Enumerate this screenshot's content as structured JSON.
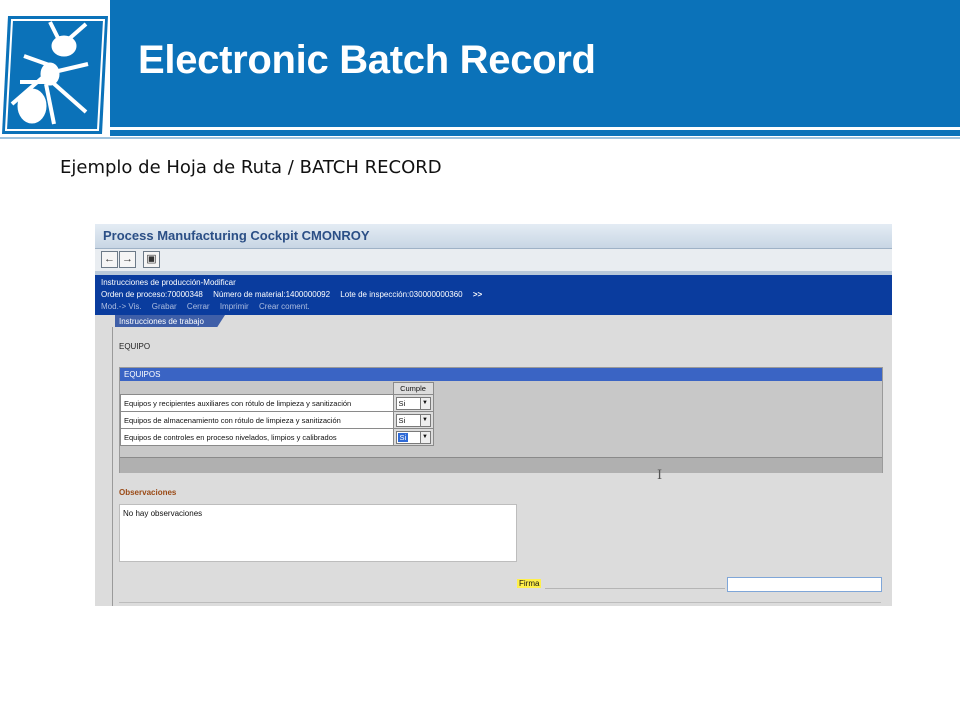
{
  "slide": {
    "title": "Electronic Batch Record",
    "subtitle": "Ejemplo de Hoja de Ruta / BATCH RECORD",
    "logo": "ant-logo-icon"
  },
  "sap": {
    "window_title": "Process Manufacturing Cockpit CMONROY",
    "toolbar": {
      "back_icon": "arrow-left-icon",
      "forward_icon": "arrow-right-icon",
      "screen_icon": "screen-icon"
    },
    "header": {
      "title": "Instrucciones de producción-Modificar",
      "order": "Orden de proceso:70000348",
      "material": "Número de material:1400000092",
      "inspection_lot": "Lote de inspección:030000000360",
      "more": ">>"
    },
    "menu": [
      "Mod.-> Vis.",
      "Grabar",
      "Cerrar",
      "Imprimir",
      "Crear coment."
    ],
    "tab": "Instrucciones de trabajo",
    "section_title": "EQUIPO",
    "group": {
      "title": "EQUIPOS",
      "column_header": "Cumple",
      "rows": [
        {
          "label": "Equipos y recipientes auxiliares con rótulo de limpieza y sanitización",
          "value": "Si"
        },
        {
          "label": "Equipos de almacenamiento con rótulo de limpieza y sanitización",
          "value": "Si"
        },
        {
          "label": "Equipos de controles en proceso nivelados, limpios y calibrados",
          "value": "Si"
        }
      ]
    },
    "observations": {
      "label": "Observaciones",
      "text": "No hay observaciones"
    },
    "signature": {
      "label": "Firma",
      "value": ""
    },
    "text_cursor": "I"
  }
}
